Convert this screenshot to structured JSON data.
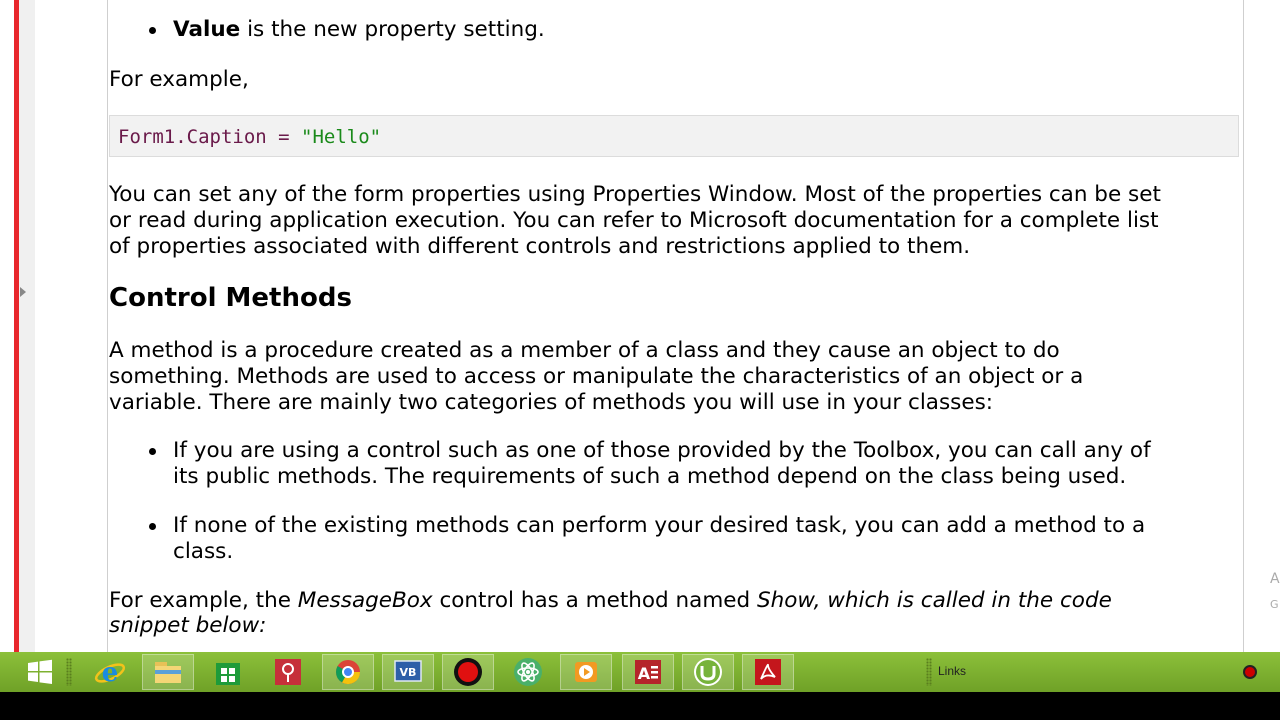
{
  "document": {
    "bullet_value_bold": "Value",
    "bullet_value_rest": " is the new property setting.",
    "for_example_1": "For example,",
    "code": {
      "part1": "Form1.Caption = ",
      "part2": "\"Hello\""
    },
    "para1": [
      "You can set any of the form properties using Properties Window. Most of the properties can be set",
      "or read during application execution. You can refer to Microsoft documentation for a complete list",
      "of properties associated with different controls and restrictions applied to them."
    ],
    "heading": "Control Methods",
    "para2": [
      "A method is a procedure created as a member of a class and they cause an object to do",
      "something. Methods are used to access or manipulate the characteristics of an object or a",
      "variable. There are mainly two categories of methods you will use in your classes:"
    ],
    "bullet1": [
      "If you are using a control such as one of those provided by the Toolbox, you can call any of",
      "its public methods. The requirements of such a method depend on the class being used."
    ],
    "bullet2": [
      "If none of the existing methods can perform your desired task, you can add a method to a",
      "class."
    ],
    "last_para": {
      "a": "For example, the ",
      "b": "MessageBox",
      "c": " control has a method named ",
      "d": "Show, which is called in the code",
      "e": "snippet below:"
    }
  },
  "edge_letters": [
    "A",
    "G"
  ],
  "taskbar": {
    "links_label": "Links",
    "vb_label": "VB",
    "access_label": "A",
    "colors": {
      "start": "#8cc03a",
      "end": "#6fa127",
      "access": "#b5252a",
      "acrobat": "#c4161c",
      "store": "#1e9b3a",
      "utorrent": "#77b33b"
    }
  }
}
